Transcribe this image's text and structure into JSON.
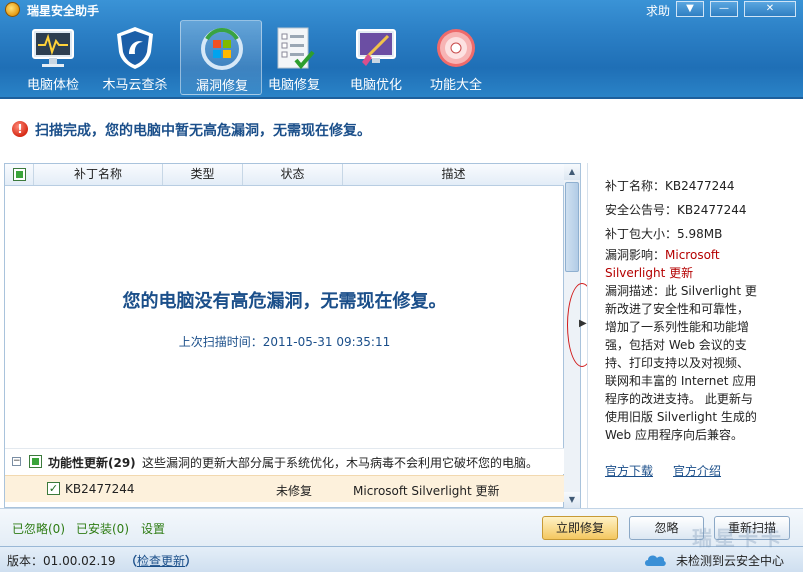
{
  "app": {
    "title": "瑞星安全助手",
    "help": "求助",
    "menu_btn": "▼",
    "min_btn": "—",
    "close_btn": "✕"
  },
  "toolbar": [
    {
      "label": "电脑体检",
      "icon": "monitor-pulse-icon"
    },
    {
      "label": "木马云查杀",
      "icon": "shield-icon"
    },
    {
      "label": "漏洞修复",
      "icon": "windows-refresh-icon"
    },
    {
      "label": "电脑修复",
      "icon": "checklist-icon"
    },
    {
      "label": "电脑优化",
      "icon": "broom-monitor-icon"
    },
    {
      "label": "功能大全",
      "icon": "disc-icon"
    }
  ],
  "banner": {
    "icon": "!",
    "text": "扫描完成，您的电脑中暂无高危漏洞，无需现在修复。"
  },
  "table": {
    "columns": [
      "补丁名称",
      "类型",
      "状态",
      "描述"
    ],
    "empty_message": "您的电脑没有高危漏洞，无需现在修复。",
    "last_scan": "上次扫描时间：2011-05-31 09:35:11",
    "group": {
      "expander": "−",
      "title": "功能性更新(29)",
      "description": "这些漏洞的更新大部分属于系统优化，木马病毒不会利用它破坏您的电脑。"
    },
    "rows": [
      {
        "check": "✓",
        "name": "KB2477244",
        "status": "未修复",
        "description": "Microsoft Silverlight 更新"
      }
    ]
  },
  "scrollbar": {
    "up": "▲",
    "down": "▼"
  },
  "collapse_arrow": "▶",
  "detail": {
    "name_label": "补丁名称：",
    "name": "KB2477244",
    "bulletin_label": "安全公告号：",
    "bulletin": "KB2477244",
    "size_label": "补丁包大小：",
    "size": "5.98MB",
    "impact_label": "漏洞影响：",
    "impact_1": "Microsoft",
    "impact_2": "Silverlight 更新",
    "desc_lines": [
      "漏洞描述：此 Silverlight 更",
      "新改进了安全性和可靠性，",
      "增加了一系列性能和功能增",
      "强，包括对 Web 会议的支",
      "持、打印支持以及对视频、",
      "联网和丰富的 Internet 应用",
      "程序的改进支持。 此更新与",
      "使用旧版 Silverlight 生成的",
      "Web 应用程序向后兼容。"
    ],
    "official_download": "官方下载",
    "official_intro": "官方介绍"
  },
  "bottom": {
    "ignored": "已忽略(0)",
    "installed": "已安装(0)",
    "settings": "设置",
    "fix_now": "立即修复",
    "ignore": "忽略",
    "rescan": "重新扫描"
  },
  "status": {
    "version": "版本：01.00.02.19",
    "check_update_open": "（",
    "check_update": "检查更新",
    "check_update_close": "）",
    "cloud": "未检测到云安全中心"
  },
  "watermark": "瑞星卡卡",
  "colors": {
    "header_blue": "#2b7fc5",
    "accent_navy": "#1b4f8a",
    "red": "#b40000",
    "green_link": "#2e7c14",
    "row_highlight": "#fdf1dc"
  }
}
